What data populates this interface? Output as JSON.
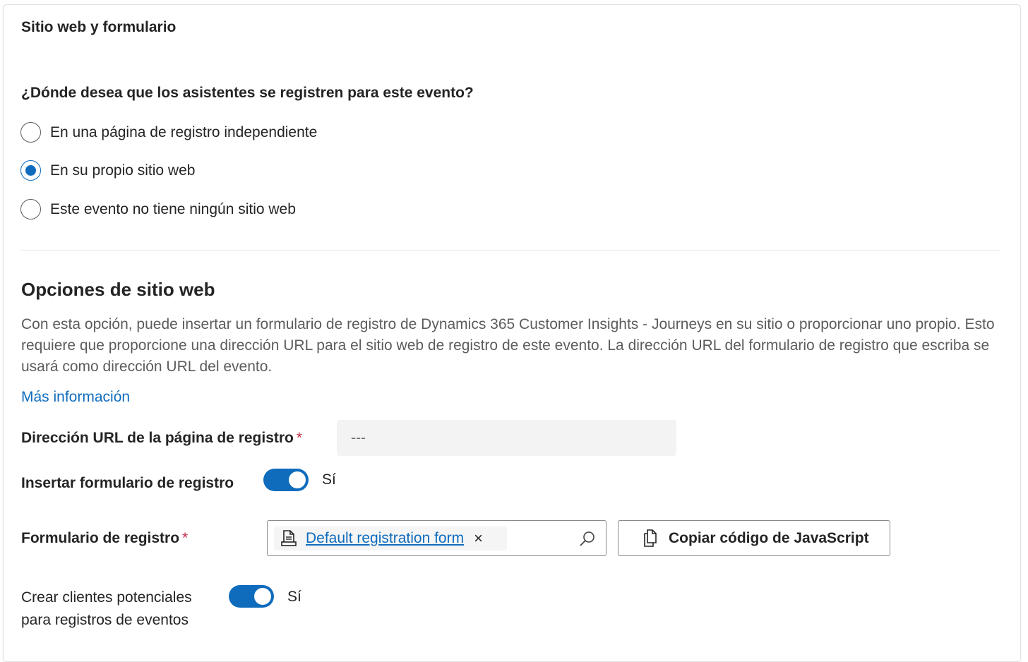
{
  "section": {
    "title": "Sitio web y formulario",
    "question": "¿Dónde desea que los asistentes se registren para este evento?",
    "options": [
      {
        "label": "En una página de registro independiente",
        "selected": false
      },
      {
        "label": "En su propio sitio web",
        "selected": true
      },
      {
        "label": "Este evento no tiene ningún sitio web",
        "selected": false
      }
    ]
  },
  "website_options": {
    "title": "Opciones de sitio web",
    "description": "Con esta opción, puede insertar un formulario de registro de Dynamics 365 Customer Insights - Journeys en su sitio o proporcionar uno propio. Esto requiere que proporcione una dirección URL para el sitio web de registro de este evento. La dirección URL del formulario de registro que escriba se usará como dirección URL del evento.",
    "more_info": "Más información"
  },
  "fields": {
    "url_label": "Dirección URL de la página de registro",
    "required_mark": "*",
    "url_value": "---",
    "embed_label": "Insertar formulario de registro",
    "embed_toggle_text": "Sí",
    "form_label": "Formulario de registro",
    "form_value": "Default registration form",
    "remove_symbol": "×",
    "copy_button": "Copiar código de JavaScript",
    "leads_label_line1": "Crear clientes potenciales",
    "leads_label_line2": "para registros de eventos",
    "leads_toggle_text": "Sí"
  },
  "colors": {
    "accent": "#0f6cbd",
    "required": "#c4314b"
  },
  "icons": {
    "form": "form-document-icon",
    "search": "search-icon",
    "copy": "copy-icon"
  }
}
